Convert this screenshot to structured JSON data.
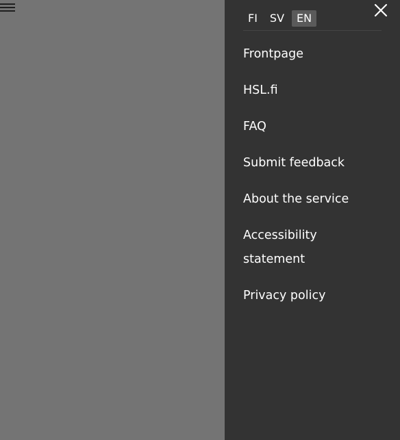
{
  "header": {
    "menu_icon": "hamburger-menu-icon"
  },
  "drawer": {
    "close_icon": "close-icon",
    "languages": [
      {
        "code": "FI",
        "active": false
      },
      {
        "code": "SV",
        "active": false
      },
      {
        "code": "EN",
        "active": true
      }
    ],
    "menu_items": [
      {
        "label": "Frontpage"
      },
      {
        "label": "HSL.fi"
      },
      {
        "label": "FAQ"
      },
      {
        "label": "Submit feedback"
      },
      {
        "label": "About the service"
      },
      {
        "label": "Accessibility statement"
      },
      {
        "label": "Privacy policy"
      }
    ]
  },
  "colors": {
    "overlay": "#747474",
    "drawer_bg": "#333333",
    "active_lang_bg": "#5a5a5a",
    "text": "#ffffff"
  }
}
